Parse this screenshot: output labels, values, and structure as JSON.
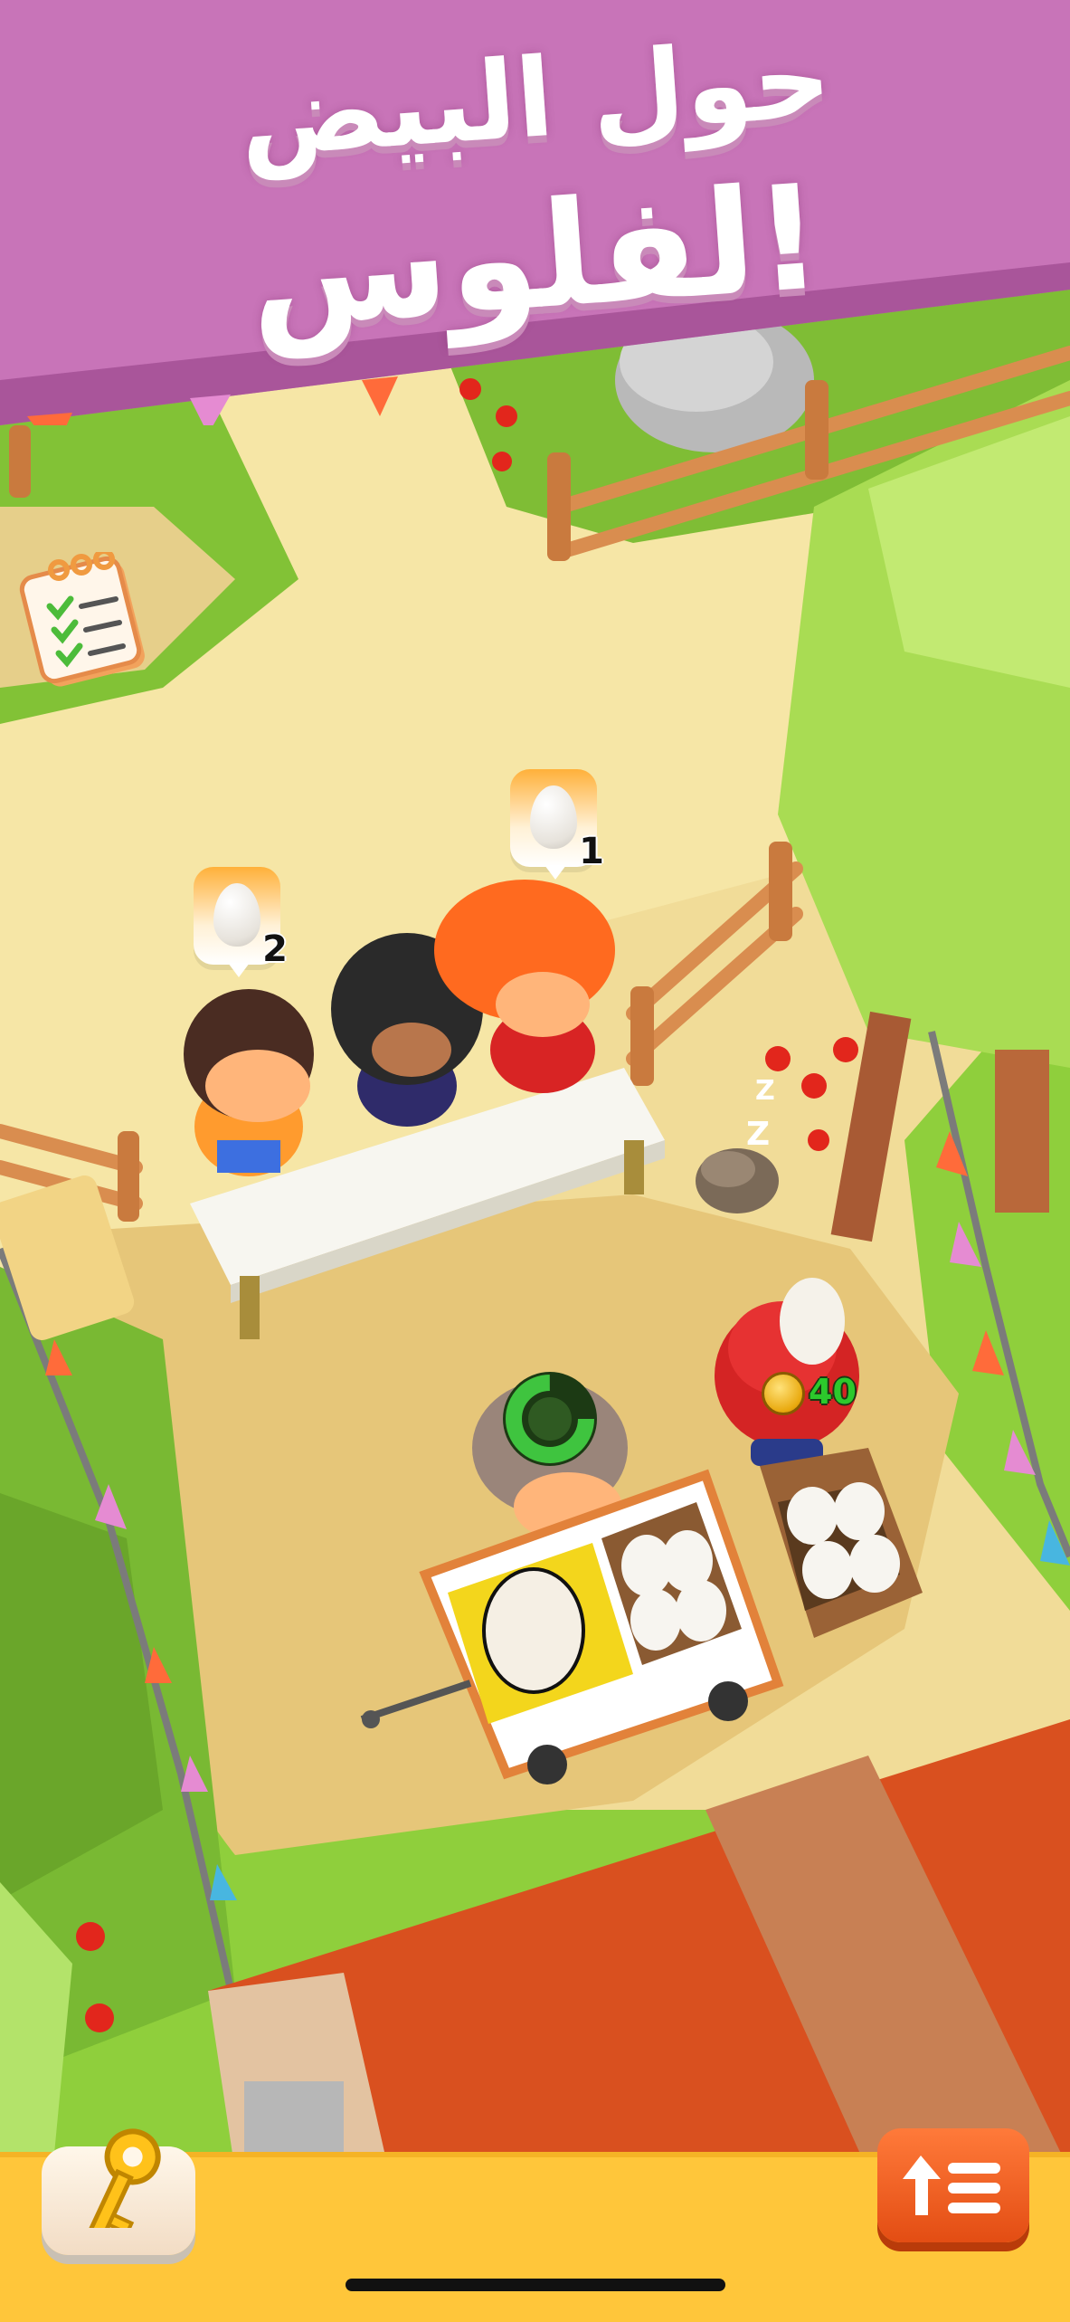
{
  "banner": {
    "line1": "حول البيض",
    "line2": "لفلوس!"
  },
  "hud": {
    "checklist_icon": "checklist-icon",
    "key_icon": "key-icon",
    "upgrade_icon": "upgrade-list-icon"
  },
  "customers": [
    {
      "egg_request": "2"
    },
    {
      "egg_request": "1"
    }
  ],
  "player": {
    "coins": "40"
  },
  "colors": {
    "banner": "#c473b8",
    "path": "#f3dfa0",
    "grass": "#8fcf3c",
    "roof": "#d9501f",
    "bottom_bar": "#ffc63a"
  }
}
